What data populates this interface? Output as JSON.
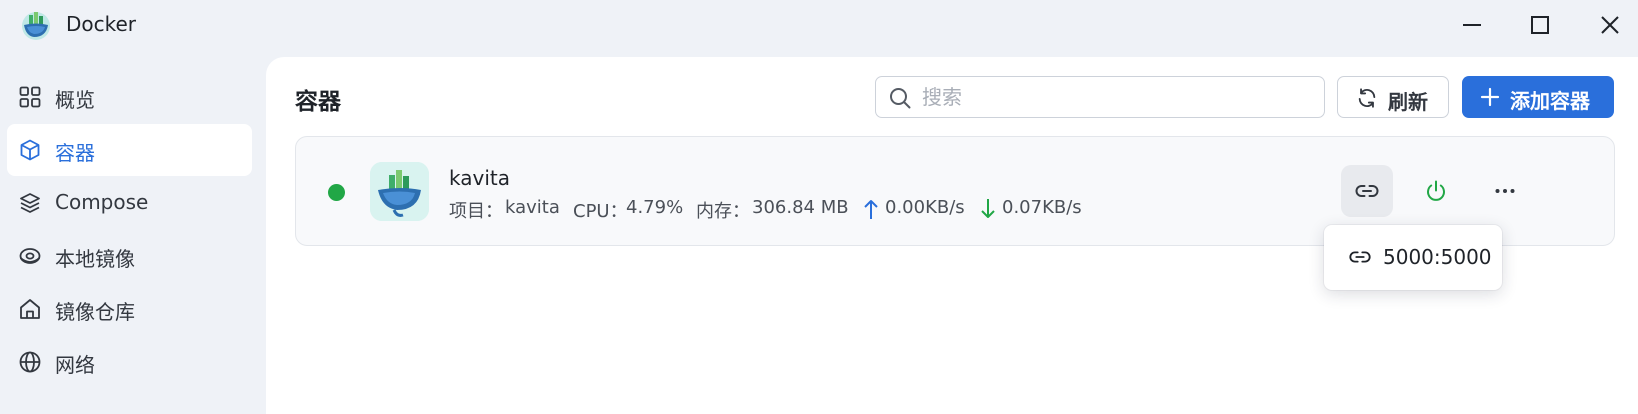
{
  "window": {
    "title": "Docker",
    "controls": [
      "minimize-icon",
      "maximize-icon",
      "close-icon"
    ]
  },
  "sidebar": {
    "items": [
      {
        "label": "概览",
        "icon": "grid-icon",
        "active": false
      },
      {
        "label": "容器",
        "icon": "cube-icon",
        "active": true
      },
      {
        "label": "Compose",
        "icon": "layers-icon",
        "active": false
      },
      {
        "label": "本地镜像",
        "icon": "disk-icon",
        "active": false
      },
      {
        "label": "镜像仓库",
        "icon": "home-icon",
        "active": false
      },
      {
        "label": "网络",
        "icon": "globe-icon",
        "active": false
      }
    ]
  },
  "main": {
    "title": "容器",
    "search": {
      "placeholder": "搜索",
      "value": ""
    },
    "refresh_label": "刷新",
    "add_label": "添加容器"
  },
  "containers": [
    {
      "name": "kavita",
      "status": "running",
      "project_label": "项目：",
      "project": "kavita",
      "cpu_label": "CPU：",
      "cpu": "4.79%",
      "memory_label": "内存：",
      "memory": "306.84 MB",
      "upload": "0.00KB/s",
      "download": "0.07KB/s"
    }
  ],
  "port_popup": {
    "icon": "link-icon",
    "ports": [
      "5000:5000"
    ]
  },
  "colors": {
    "accent": "#2a6fdb",
    "running": "#21a746",
    "upload_arrow": "#2a6fdb",
    "download_arrow": "#21a746",
    "power": "#21a746"
  }
}
